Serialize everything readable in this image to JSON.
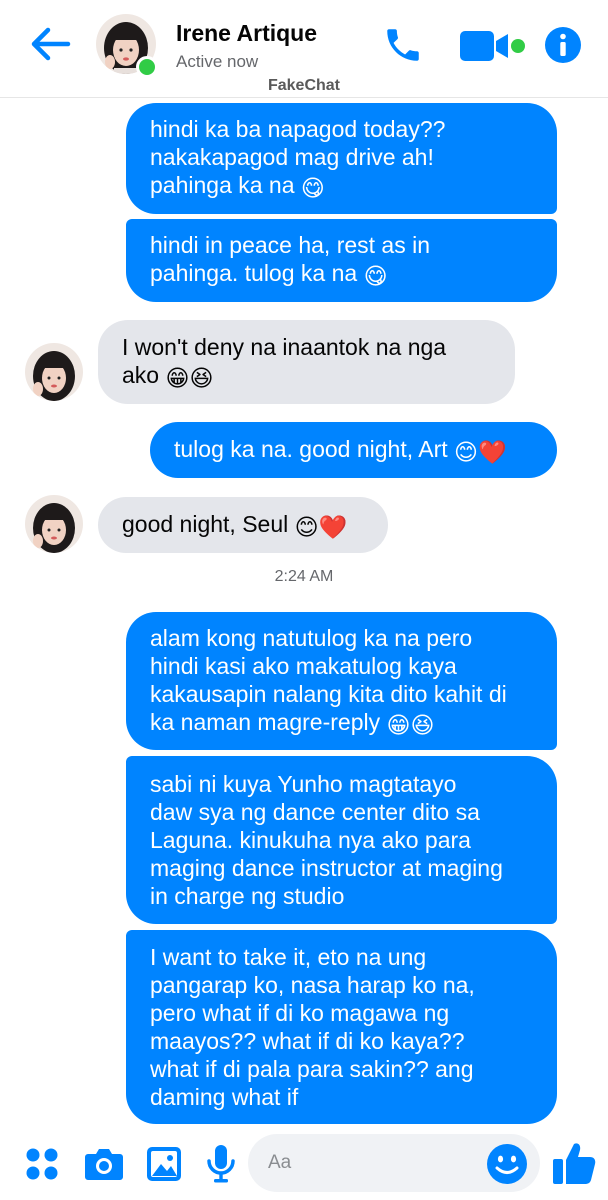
{
  "header": {
    "back_icon": "arrow-left-icon",
    "contact_name": "Irene Artique",
    "status": "Active now",
    "watermark": "FakeChat",
    "call_icon": "phone-icon",
    "video_icon": "video-camera-icon",
    "info_icon": "info-icon",
    "accent_color": "#0084ff",
    "online_color": "#31cc46"
  },
  "messages": [
    {
      "side": "out",
      "lines": [
        "hindi ka ba napagod today??",
        "nakakapagod mag drive ah!",
        "pahinga ka na"
      ],
      "emoji": [
        "😋"
      ]
    },
    {
      "side": "out",
      "lines": [
        "hindi in peace ha, rest as in",
        "pahinga. tulog ka na"
      ],
      "emoji": [
        "😋"
      ]
    },
    {
      "side": "in",
      "lines": [
        "I won't deny na inaantok na nga",
        "ako"
      ],
      "emoji": [
        "😁",
        "😆"
      ]
    },
    {
      "side": "out",
      "lines": [
        "tulog ka na. good night, Art"
      ],
      "emoji": [
        "😊",
        "❤️"
      ]
    },
    {
      "side": "in",
      "lines": [
        "good night, Seul"
      ],
      "emoji": [
        "😊",
        "❤️"
      ]
    },
    {
      "side": "out",
      "lines": [
        "alam kong natutulog ka na pero",
        "hindi kasi ako makatulog kaya",
        "kakausapin nalang kita dito kahit di",
        "ka naman magre-reply"
      ],
      "emoji": [
        "😁",
        "😆"
      ]
    },
    {
      "side": "out",
      "lines": [
        "sabi ni kuya Yunho magtatayo",
        "daw sya ng dance center dito sa",
        "Laguna. kinukuha nya ako para",
        "maging dance instructor at maging",
        "in charge ng studio"
      ],
      "emoji": []
    },
    {
      "side": "out",
      "lines": [
        "I want to take it, eto na ung",
        "pangarap ko, nasa harap ko na,",
        "pero what if di ko magawa ng",
        "maayos?? what if di ko kaya??",
        "what if di pala para sakin?? ang",
        "daming what if"
      ],
      "emoji": []
    }
  ],
  "timestamp": "2:24 AM",
  "composer": {
    "placeholder": "Aa",
    "icons": [
      "menu-dots-icon",
      "camera-icon",
      "image-icon",
      "microphone-icon",
      "smiley-icon",
      "thumbs-up-icon"
    ]
  }
}
